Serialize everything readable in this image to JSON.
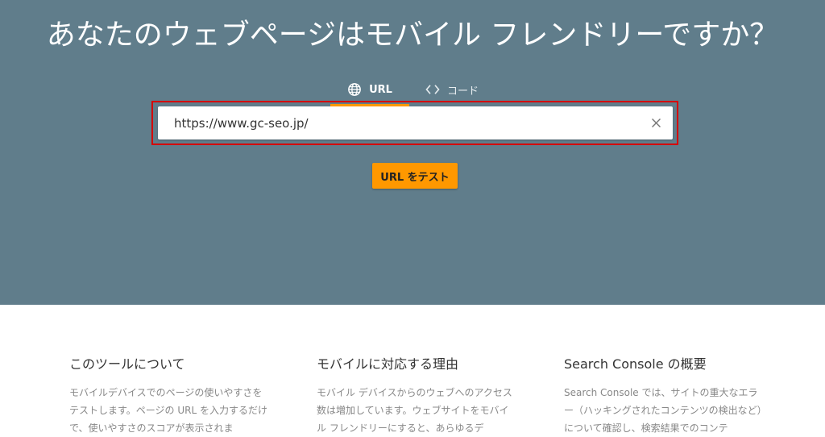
{
  "hero": {
    "title": "あなたのウェブページはモバイル フレンドリーですか？",
    "background_color": "#607d8b"
  },
  "tabs": [
    {
      "label": "URL",
      "icon": "globe-icon",
      "active": true
    },
    {
      "label": "コード",
      "icon": "code-brackets-icon",
      "active": false
    }
  ],
  "url_input": {
    "value": "https://www.gc-seo.jp/",
    "clear_icon": "close-icon"
  },
  "test_button": {
    "label": "URL をテスト",
    "color": "#ff9800"
  },
  "highlight_color": "#d50000",
  "info_sections": [
    {
      "heading": "このツールについて",
      "body": "モバイルデバイスでのページの使いやすさをテストします。ページの URL を入力するだけで、使いやすさのスコアが表示されま"
    },
    {
      "heading": "モバイルに対応する理由",
      "body": "モバイル デバイスからのウェブへのアクセス数は増加しています。ウェブサイトをモバイル フレンドリーにすると、あらゆるデ"
    },
    {
      "heading": "Search Console の概要",
      "body": "Search Console では、サイトの重大なエラー（ハッキングされたコンテンツの検出など）について確認し、検索結果でのコンテ"
    }
  ]
}
